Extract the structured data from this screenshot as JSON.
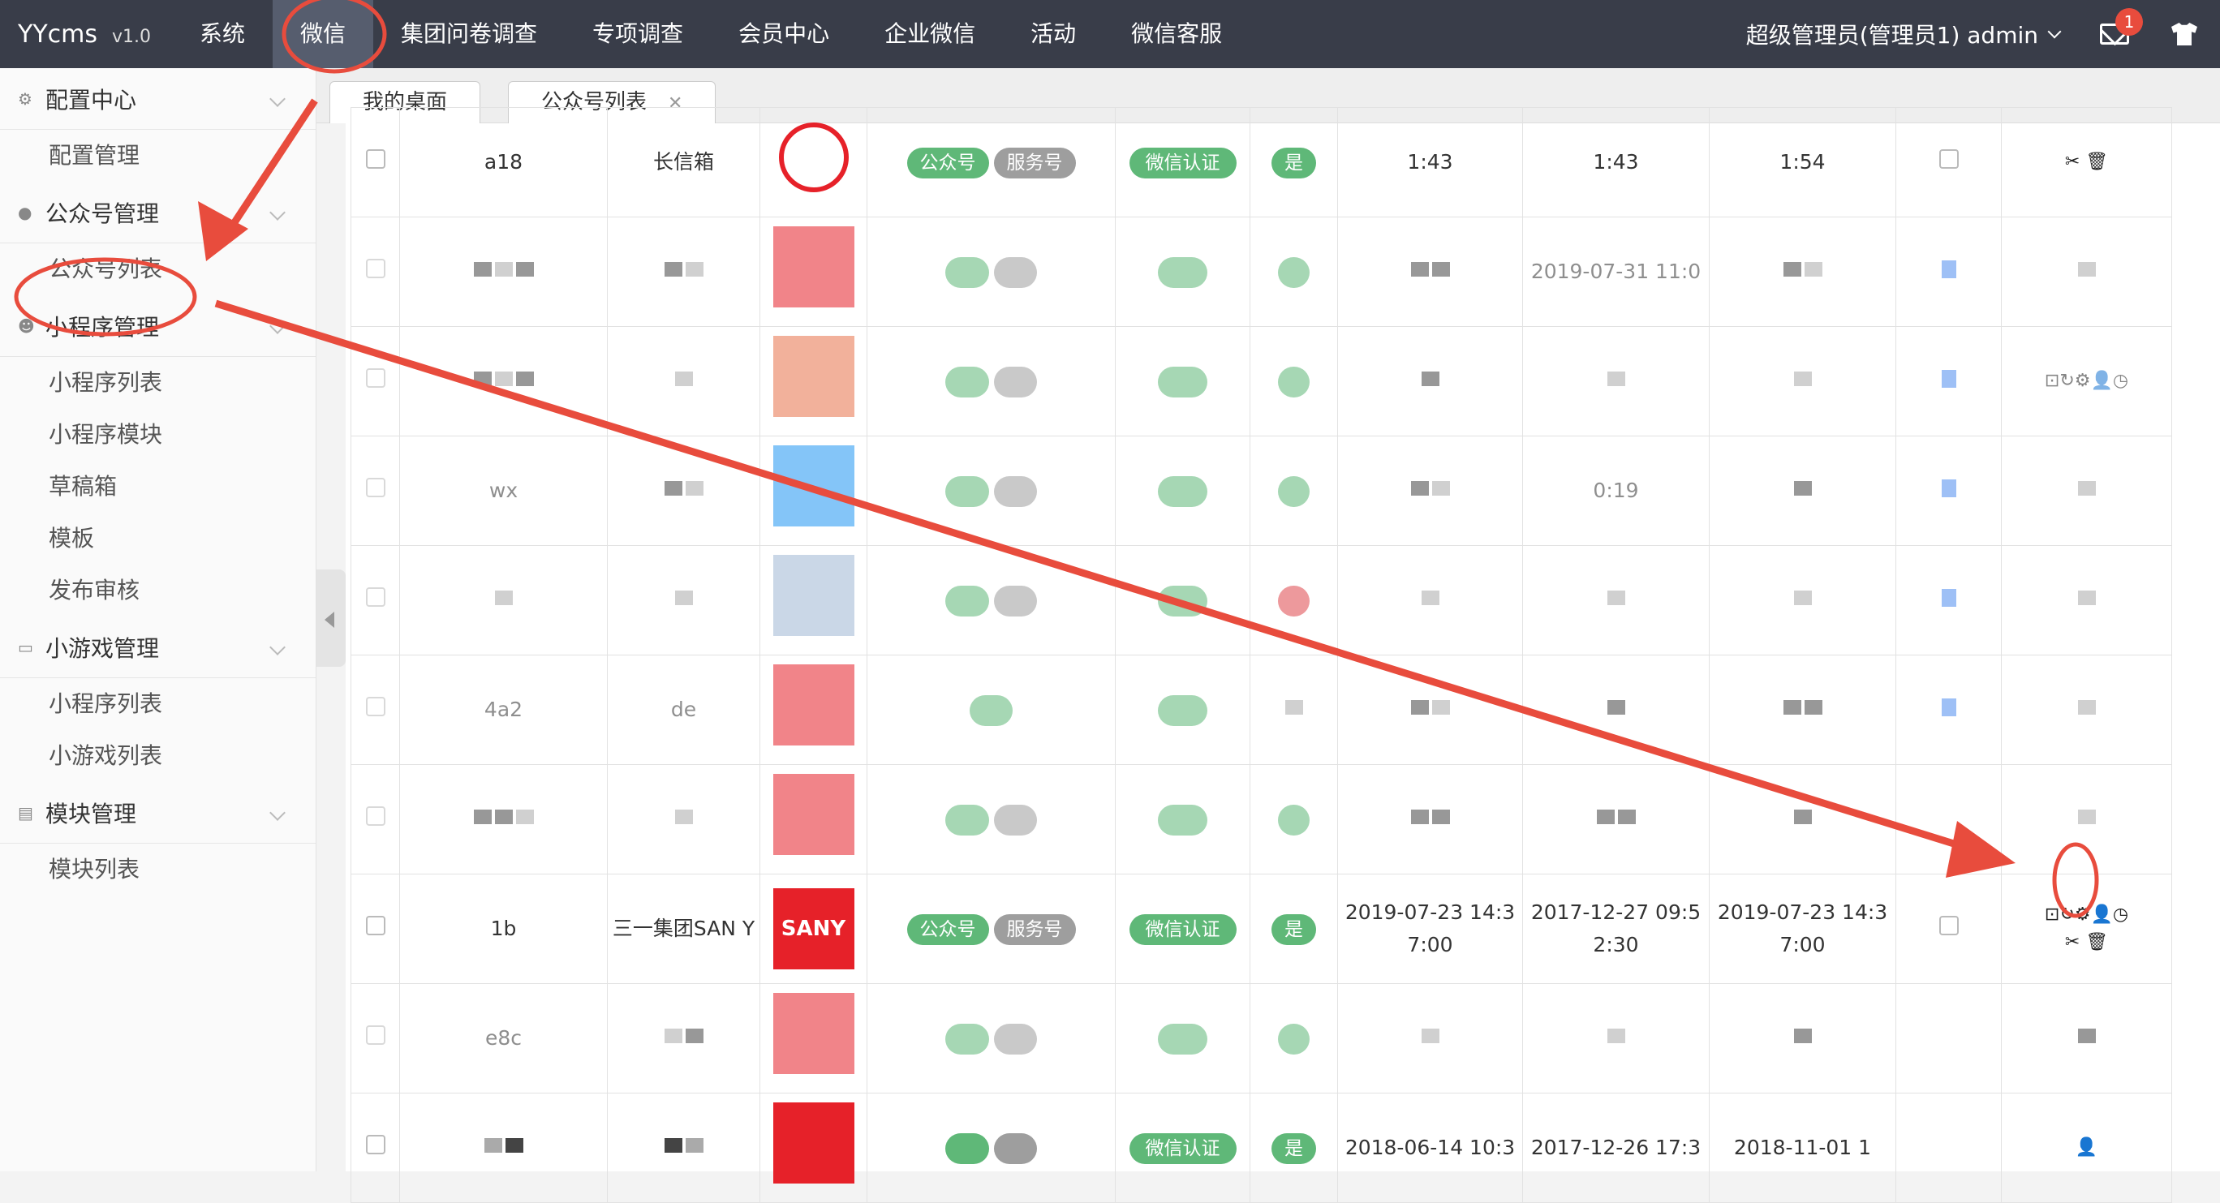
{
  "app": {
    "name": "YYcms",
    "version": "v1.0"
  },
  "nav": [
    "系统",
    "微信",
    "集团问卷调查",
    "专项调查",
    "会员中心",
    "企业微信",
    "活动",
    "微信客服"
  ],
  "user": "超级管理员(管理员1)  admin",
  "notification_count": "1",
  "sidebar": {
    "groups": [
      {
        "label": "配置中心",
        "items": [
          "配置管理"
        ]
      },
      {
        "label": "公众号管理",
        "items": [
          "公众号列表"
        ]
      },
      {
        "label": "小程序管理",
        "items": [
          "小程序列表",
          "小程序模块",
          "草稿箱",
          "模板",
          "发布审核"
        ]
      },
      {
        "label": "小游戏管理",
        "items": [
          "小程序列表",
          "小游戏列表"
        ]
      },
      {
        "label": "模块管理",
        "items": [
          "模块列表"
        ]
      }
    ]
  },
  "tabs": [
    "我的桌面",
    "公众号列表"
  ],
  "table": {
    "row1": {
      "appid": "a18",
      "name": "长信箱",
      "type": "公众号",
      "service": "服务号",
      "verify": "微信认证",
      "yes": "是",
      "t1": "1:43",
      "t2": "1:43",
      "t3": "1:54"
    },
    "row2": {
      "t2": "2019-07-31 11:0",
      "id": "ob"
    },
    "row4": {
      "appid": "wx",
      "t2": "0:19"
    },
    "row6": {
      "appid": "4a2",
      "name": "de"
    },
    "row8": {
      "appid": "1b",
      "name": "三一集团SAN Y",
      "logo": "SANY",
      "type": "公众号",
      "service": "服务号",
      "verify": "微信认证",
      "yes": "是",
      "t1": "2019-07-23 14:3 7:00",
      "t2": "2017-12-27 09:5 2:30",
      "t3": "2019-07-23 14:3 7:00"
    },
    "row9": {
      "appid": "e8c"
    },
    "row10": {
      "verify": "微信认证",
      "yes": "是",
      "t1": "2018-06-14 10:3",
      "t2": "2017-12-26 17:3",
      "t3": "2018-11-01 1"
    }
  }
}
